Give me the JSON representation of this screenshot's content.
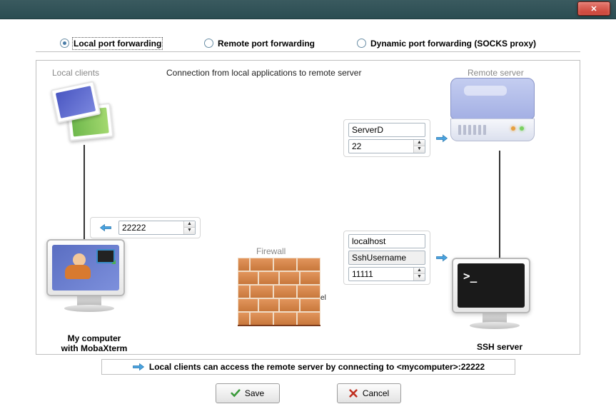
{
  "titlebar": {
    "close_glyph": "✕"
  },
  "radios": {
    "local": "Local port forwarding",
    "remote": "Remote port forwarding",
    "dynamic": "Dynamic port forwarding (SOCKS proxy)"
  },
  "panel": {
    "local_clients": "Local clients",
    "connection_desc": "Connection from local applications to remote server",
    "remote_server": "Remote server",
    "firewall": "Firewall",
    "ssh_tunnel": "SSH tunnel",
    "my_computer_line1": "My computer",
    "my_computer_line2": "with MobaXterm",
    "ssh_server": "SSH server"
  },
  "fields": {
    "local_port": "22222",
    "remote_host": "ServerD",
    "remote_port": "22",
    "ssh_host": "localhost",
    "ssh_user": "SshUsername",
    "ssh_port": "11111"
  },
  "footer": {
    "tip": "Local clients can access the remote server by connecting to <mycomputer>:22222"
  },
  "buttons": {
    "save": "Save",
    "cancel": "Cancel"
  }
}
